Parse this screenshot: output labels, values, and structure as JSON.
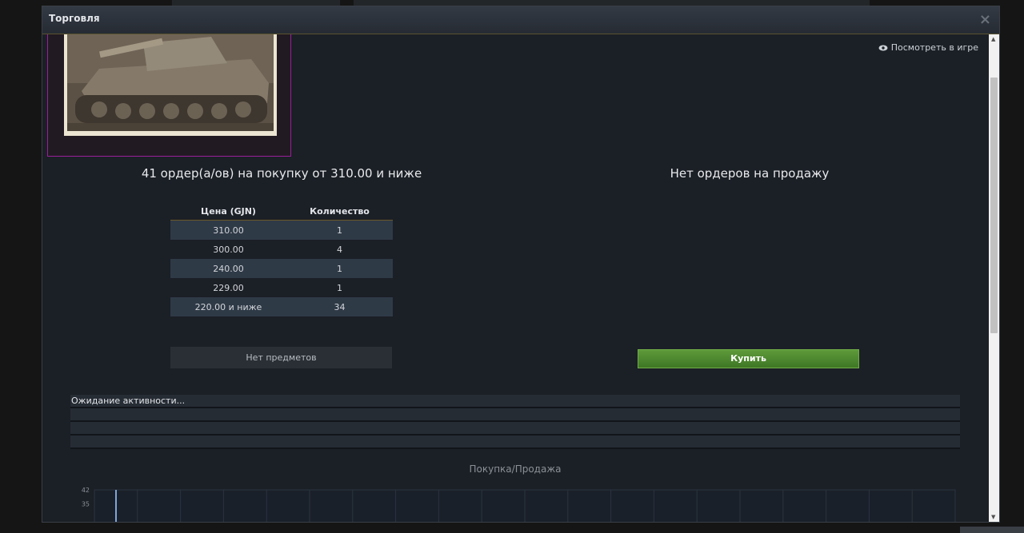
{
  "window": {
    "title": "Торговля",
    "close_icon": "×"
  },
  "item": {
    "view_in_game": "Посмотреть в игре",
    "image_border_color": "#9a1f9b"
  },
  "buy_orders": {
    "heading": "41 ордер(а/ов) на покупку от 310.00 и ниже",
    "columns": [
      "Цена (GJN)",
      "Количество"
    ],
    "rows": [
      {
        "price": "310.00",
        "qty": "1"
      },
      {
        "price": "300.00",
        "qty": "4"
      },
      {
        "price": "240.00",
        "qty": "1"
      },
      {
        "price": "229.00",
        "qty": "1"
      },
      {
        "price": "220.00 и ниже",
        "qty": "34"
      }
    ],
    "no_items_label": "Нет предметов"
  },
  "sell_orders": {
    "heading": "Нет ордеров на продажу",
    "buy_button": "Купить"
  },
  "activity": {
    "status": "Ожидание активности..."
  },
  "chart_data": {
    "type": "bar",
    "title": "Покупка/Продажа",
    "ytick_labels": [
      "42",
      "35"
    ],
    "ylim": [
      0,
      42
    ],
    "values": [
      42
    ],
    "grid": true
  },
  "colors": {
    "accent_green": "#4d8a2f",
    "row_highlight": "#2f3a47"
  }
}
